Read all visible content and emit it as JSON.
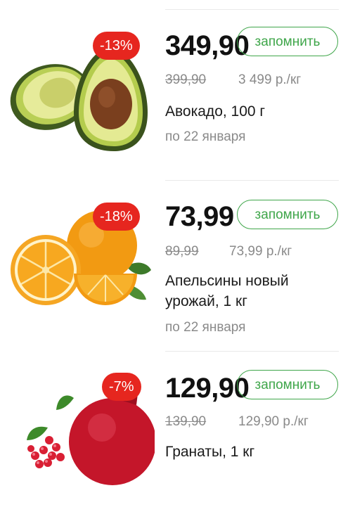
{
  "products": [
    {
      "id": "avocado",
      "discount": "-13%",
      "price": "349,90",
      "old_price": "399,90",
      "unit_price": "3 499 р./кг",
      "name": "Авокадо, 100 г",
      "valid_until": "по 22 января",
      "remember_label": "запомнить",
      "image_icon": "avocado-image"
    },
    {
      "id": "oranges",
      "discount": "-18%",
      "price": "73,99",
      "old_price": "89,99",
      "unit_price": "73,99 р./кг",
      "name": "Апельсины новый урожай, 1 кг",
      "valid_until": "по 22 января",
      "remember_label": "запомнить",
      "image_icon": "orange-image"
    },
    {
      "id": "pomegranate",
      "discount": "-7%",
      "price": "129,90",
      "old_price": "139,90",
      "unit_price": "129,90 р./кг",
      "name": "Гранаты, 1 кг",
      "valid_until": "",
      "remember_label": "запомнить",
      "image_icon": "pomegranate-image"
    }
  ],
  "colors": {
    "badge": "#e6261f",
    "accent_green": "#3fa64a",
    "muted_text": "#8a8a8a",
    "price_text": "#111111"
  }
}
